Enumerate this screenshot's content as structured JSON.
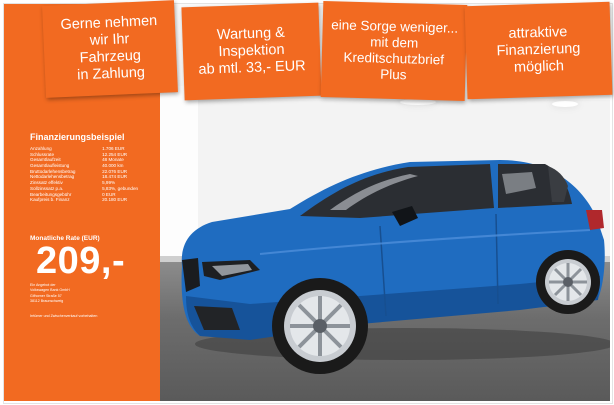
{
  "banners": [
    {
      "text": "Gerne nehmen\nwir Ihr\nFahrzeug\nin Zahlung"
    },
    {
      "text": "Wartung &\nInspektion\nab mtl. 33,- EUR"
    },
    {
      "text": "eine Sorge weniger...\nmit dem\nKreditschutzbrief\nPlus"
    },
    {
      "text": "attraktive\nFinanzierung\nmöglich"
    }
  ],
  "financing": {
    "title": "Finanzierungsbeispiel",
    "rows": [
      {
        "label": "Anzahlung",
        "value": "1.706 EUR"
      },
      {
        "label": "Schlussrate",
        "value": "12.254 EUR"
      },
      {
        "label": "Gesamtlaufzeit",
        "value": "48 Monate"
      },
      {
        "label": "Gesamtlaufleistung",
        "value": "40.000 km"
      },
      {
        "label": "Bruttodarlehensbetrag",
        "value": "22.076 EUR"
      },
      {
        "label": "Nettodarlehensbetrag",
        "value": "18.474 EUR"
      },
      {
        "label": "Zinssatz effektiv",
        "value": "5,99%"
      },
      {
        "label": "Sollzinssatz p.a.",
        "value": "5,83%, gebunden"
      },
      {
        "label": "Bearbeitungsgebühr",
        "value": "0 EUR"
      },
      {
        "label": "Kaufpreis b. Finanz",
        "value": "20.180 EUR"
      }
    ],
    "rate_label": "Monatliche Rate (EUR)",
    "price": "209,-",
    "dealer_lines": [
      "Ein Angebot der",
      "Volkswagen Bank GmbH",
      "Gifhorner Straße 57",
      "38112 Braunschweig"
    ],
    "footnote": "Irrtümer und Zwischenverkauf vorbehalten"
  },
  "colors": {
    "orange": "#f26a21",
    "car_blue": "#1f6cc0",
    "floor": "#6d6d6d"
  }
}
